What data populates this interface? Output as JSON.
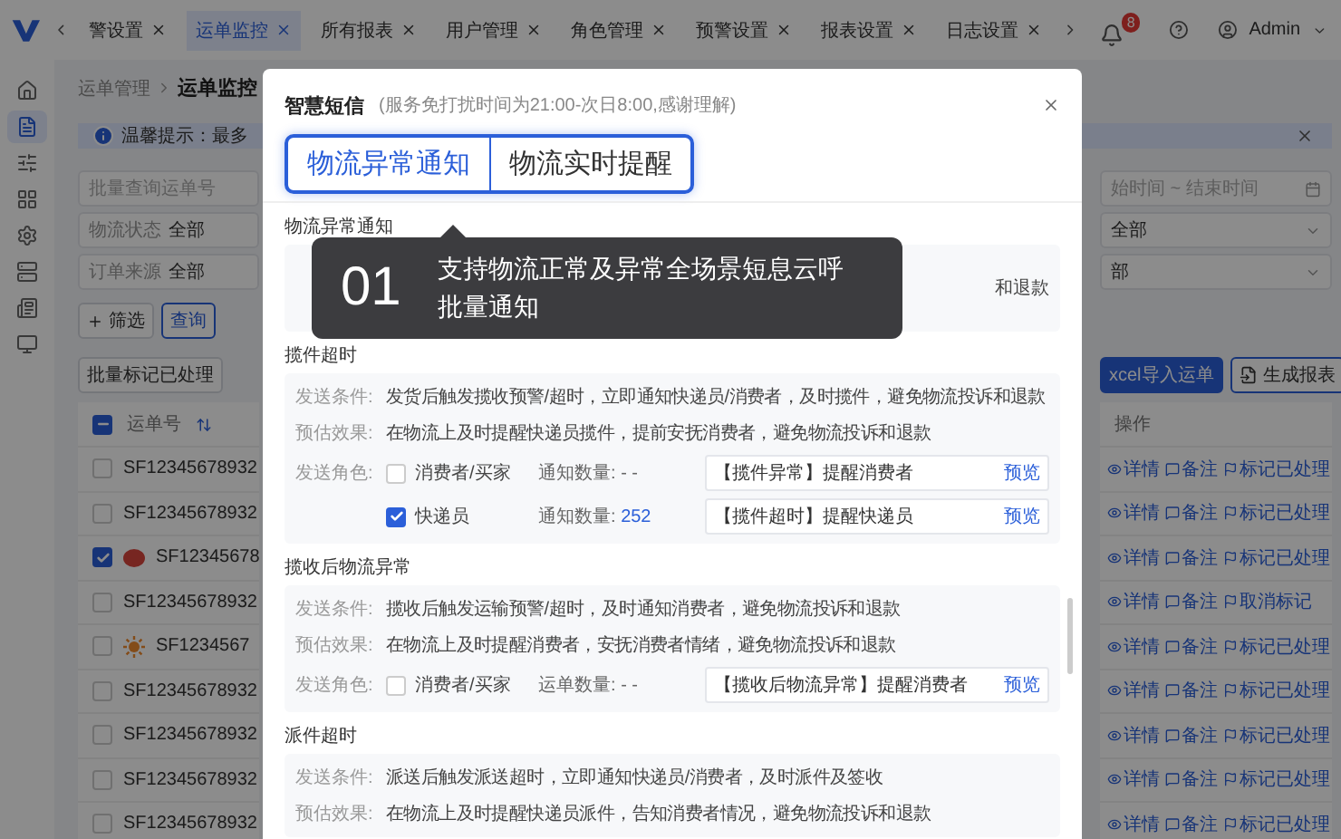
{
  "topbar": {
    "tabs": [
      {
        "label": "警设置",
        "selected": false
      },
      {
        "label": "运单监控",
        "selected": true
      },
      {
        "label": "所有报表",
        "selected": false
      },
      {
        "label": "用户管理",
        "selected": false
      },
      {
        "label": "角色管理",
        "selected": false
      },
      {
        "label": "预警设置",
        "selected": false
      },
      {
        "label": "报表设置",
        "selected": false
      },
      {
        "label": "日志设置",
        "selected": false
      }
    ],
    "badge": "8",
    "user": "Admin"
  },
  "sidebar": [
    {
      "selected": false
    },
    {
      "selected": true
    },
    {
      "selected": false
    },
    {
      "selected": false
    },
    {
      "selected": false
    },
    {
      "selected": false
    },
    {
      "selected": false
    },
    {
      "selected": false
    }
  ],
  "breadcrumb": [
    "运单管理",
    "运单监控"
  ],
  "notice": {
    "text": "温馨提示：最多"
  },
  "filters": {
    "left": [
      {
        "placeholder": "批量查询运单号"
      },
      {
        "label": "物流状态",
        "value": "全部"
      },
      {
        "label": "订单来源",
        "value": "全部"
      }
    ],
    "right": [
      {
        "placeholder": "始时间 ~ 结束时间"
      },
      {
        "value": "全部"
      },
      {
        "value": "部"
      }
    ]
  },
  "actions": {
    "left": [
      "筛选",
      "查询"
    ],
    "batch": "批量标记已处理",
    "right": [
      {
        "label": "xcel导入运单",
        "kind": "primary"
      },
      {
        "label": "生成报表",
        "kind": "outline"
      }
    ]
  },
  "table": {
    "select_all": {
      "checked": true,
      "indeterminate": true
    },
    "columns": [
      "运单号",
      "操作"
    ],
    "rows": [
      {
        "checked": false,
        "kind": "plain",
        "waybill": "SF12345678932",
        "actions": [
          "详情",
          "备注",
          "标记已处理"
        ]
      },
      {
        "checked": false,
        "kind": "plain",
        "waybill": "SF12345678932",
        "actions": [
          "详情",
          "备注",
          "标记已处理"
        ]
      },
      {
        "checked": true,
        "kind": "flagged",
        "waybill": "SF12345678",
        "actions": [
          "详情",
          "备注",
          "标记已处理"
        ]
      },
      {
        "checked": false,
        "kind": "plain",
        "waybill": "SF12345678932",
        "actions": [
          "详情",
          "备注",
          "取消标记"
        ]
      },
      {
        "checked": false,
        "kind": "starred",
        "waybill": "SF1234567",
        "actions": [
          "详情",
          "备注",
          "标记已处理"
        ]
      },
      {
        "checked": false,
        "kind": "plain",
        "waybill": "SF12345678932",
        "actions": [
          "详情",
          "备注",
          "标记已处理"
        ]
      },
      {
        "checked": false,
        "kind": "plain",
        "waybill": "SF12345678932",
        "actions": [
          "详情",
          "备注",
          "标记已处理"
        ]
      },
      {
        "checked": false,
        "kind": "plain",
        "waybill": "SF12345678932",
        "actions": [
          "详情",
          "备注",
          "标记已处理"
        ]
      },
      {
        "checked": false,
        "kind": "plain",
        "waybill": "SF12345678932",
        "actions": [
          "详情",
          "备注",
          "标记已处理"
        ]
      }
    ]
  },
  "modal": {
    "title": "智慧短信",
    "note": "(服务免打扰时间为21:00-次日8:00,感谢理解)",
    "tabs": [
      {
        "label": "物流异常通知",
        "selected": true
      },
      {
        "label": "物流实时提醒",
        "selected": false
      }
    ],
    "sections": [
      {
        "title": "物流异常通知",
        "kind": "partial",
        "fragment": "和退款"
      },
      {
        "title": "揽件超时",
        "kind": "full",
        "lines": [
          {
            "label": "发送条件:",
            "text": "发货后触发揽收预警/超时，立即通知快递员/消费者，及时揽件，避免物流投诉和退款"
          },
          {
            "label": "预估效果:",
            "text": "在物流上及时提醒快递员揽件，提前安抚消费者，避免物流投诉和退款"
          }
        ],
        "role_label": "发送角色:",
        "roles": [
          {
            "name": "消费者/买家",
            "checked": false,
            "count_label": "通知数量:",
            "count": "- -",
            "template": "【揽件异常】提醒消费者",
            "preview": "预览"
          },
          {
            "name": "快递员",
            "checked": true,
            "count_label": "通知数量:",
            "count": "252",
            "template": "【揽件超时】提醒快递员",
            "preview": "预览"
          }
        ]
      },
      {
        "title": "揽收后物流异常",
        "kind": "full",
        "lines": [
          {
            "label": "发送条件:",
            "text": "揽收后触发运输预警/超时，及时通知消费者，避免物流投诉和退款"
          },
          {
            "label": "预估效果:",
            "text": "在物流上及时提醒消费者，安抚消费者情绪，避免物流投诉和退款"
          }
        ],
        "role_label": "发送角色:",
        "roles": [
          {
            "name": "消费者/买家",
            "checked": false,
            "count_label": "运单数量:",
            "count": "- -",
            "template": "【揽收后物流异常】提醒消费者",
            "preview": "预览"
          }
        ]
      },
      {
        "title": "派件超时",
        "kind": "full",
        "lines": [
          {
            "label": "发送条件:",
            "text": "派送后触发派送超时，立即通知快递员/消费者，及时派件及签收"
          },
          {
            "label": "预估效果:",
            "text": "在物流上及时提醒快递员派件，告知消费者情况，避免物流投诉和退款"
          }
        ]
      }
    ]
  },
  "tooltip": {
    "number": "01",
    "text": "支持物流正常及异常全场景短息云呼批量通知"
  }
}
